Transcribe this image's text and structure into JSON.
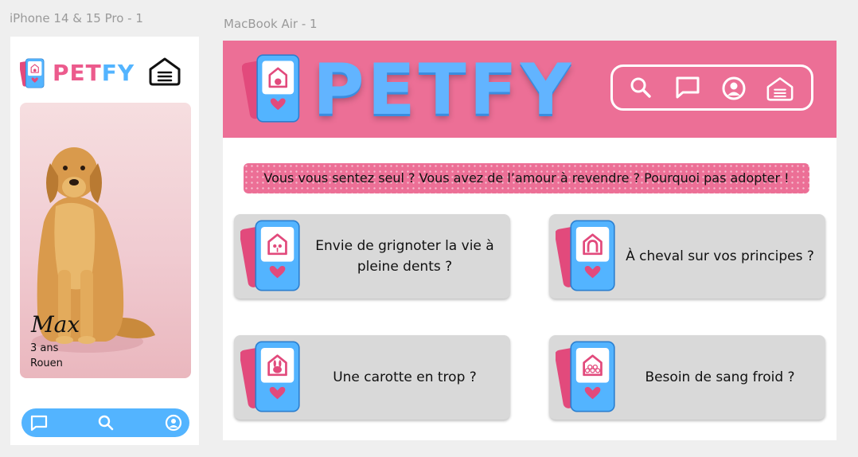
{
  "frames": {
    "phone_label": "iPhone 14 & 15 Pro - 1",
    "mac_label": "MacBook Air - 1"
  },
  "brand": {
    "name_part1": "PET",
    "name_part2": "FY",
    "name_full": "PETFY",
    "pink": "#ec6f96",
    "blue": "#53b4ff",
    "dark_pink": "#e24a7c"
  },
  "phone": {
    "menu_icon": "house-menu-icon",
    "pet": {
      "name": "Max",
      "age": "3 ans",
      "city": "Rouen"
    },
    "nav": [
      {
        "icon": "chat-icon"
      },
      {
        "icon": "search-icon"
      },
      {
        "icon": "profile-icon"
      }
    ]
  },
  "mac": {
    "toolbar": [
      {
        "icon": "search-icon"
      },
      {
        "icon": "chat-icon"
      },
      {
        "icon": "profile-icon"
      },
      {
        "icon": "house-menu-icon"
      }
    ],
    "banner": "Vous vous sentez seul ? Vous avez de l’amour à revendre ? Pourquoi pas adopter !",
    "categories": [
      {
        "text": "Envie de grignoter la vie à pleine dents ?",
        "icon": "rodent-icon"
      },
      {
        "text": "À cheval sur vos principes ?",
        "icon": "horseshoe-icon"
      },
      {
        "text": "Une carotte en trop ?",
        "icon": "rabbit-icon"
      },
      {
        "text": "Besoin de sang froid ?",
        "icon": "reptile-scales-icon"
      }
    ]
  }
}
